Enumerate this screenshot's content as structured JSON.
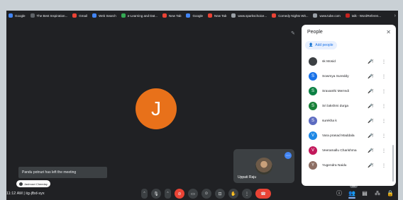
{
  "bookmarks": [
    {
      "label": "Google",
      "color": "#4285f4"
    },
    {
      "label": "The Best Inspiration...",
      "color": "#5f6368"
    },
    {
      "label": "Gmail",
      "color": "#ea4335"
    },
    {
      "label": "Web Search",
      "color": "#4285f4"
    },
    {
      "label": "e-Learning and Dat...",
      "color": "#34a853"
    },
    {
      "label": "New Tab",
      "color": "#ea4335"
    },
    {
      "label": "Google",
      "color": "#4285f4"
    },
    {
      "label": "New Tab",
      "color": "#ea4335"
    },
    {
      "label": "www.sparkschoice...",
      "color": "#9aa0a6"
    },
    {
      "label": "Comedy Nights Wit...",
      "color": "#ea4335"
    },
    {
      "label": "www.tube.com",
      "color": "#9aa0a6"
    },
    {
      "label": "talk - WordReferen...",
      "color": "#c5221f"
    }
  ],
  "main": {
    "avatar_letter": "J",
    "avatar_color": "#e8711a",
    "self_name": "Uppati Raju"
  },
  "toast": {
    "text": "Pandu potnuri has left the meeting"
  },
  "chip": {
    "text": "Jashnavi Cheeday"
  },
  "bottom": {
    "clock": "11:12 AM  |  iig-jfbd-syx",
    "participant_count": "25"
  },
  "panel": {
    "title": "People",
    "add_label": "Add people",
    "participants": [
      {
        "initial": "",
        "name": "sk Mosid",
        "color": "#3c4043"
      },
      {
        "initial": "S",
        "name": "Sowmya Sureddy",
        "color": "#1a73e8"
      },
      {
        "initial": "S",
        "name": "Sravanthi Merredi",
        "color": "#0b8043"
      },
      {
        "initial": "S",
        "name": "Sri lakshmi durga",
        "color": "#188038"
      },
      {
        "initial": "S",
        "name": "surekha k",
        "color": "#5c6bc0"
      },
      {
        "initial": "V",
        "name": "Vara prasad Maddala",
        "color": "#1e88e5"
      },
      {
        "initial": "V",
        "name": "Veeramallu Charishma",
        "color": "#c2185b"
      },
      {
        "initial": "Y",
        "name": "Yugendra Naidu",
        "color": "#8d6e63"
      }
    ]
  }
}
